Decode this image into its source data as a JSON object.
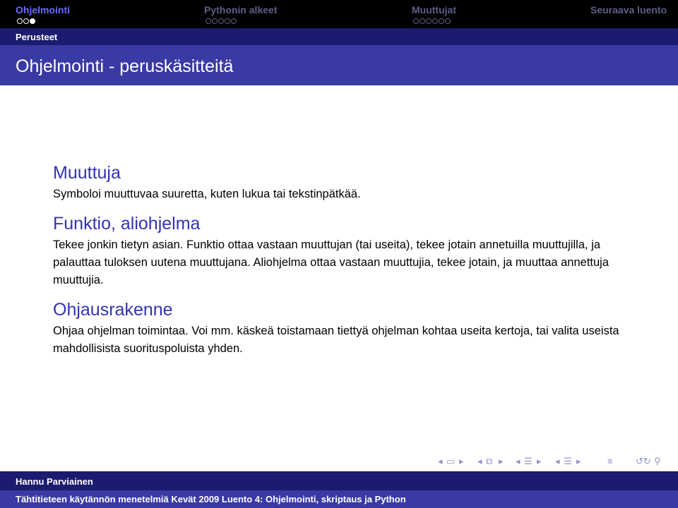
{
  "nav": {
    "sections": [
      {
        "label": "Ohjelmointi",
        "active": true
      },
      {
        "label": "Pythonin alkeet",
        "active": false
      },
      {
        "label": "Muuttujat",
        "active": false
      },
      {
        "label": "Seuraava luento",
        "active": false
      }
    ]
  },
  "subsection": "Perusteet",
  "frame_title": "Ohjelmointi - peruskäsitteitä",
  "blocks": [
    {
      "title": "Muuttuja",
      "text": "Symboloi muuttuvaa suuretta, kuten lukua tai tekstinpätkää."
    },
    {
      "title": "Funktio, aliohjelma",
      "text": "Tekee jonkin tietyn asian. Funktio ottaa vastaan muuttujan (tai useita), tekee jotain annetuilla muuttujilla, ja palauttaa tuloksen uutena muuttujana. Aliohjelma ottaa vastaan muuttujia, tekee jotain, ja muuttaa annettuja muuttujia."
    },
    {
      "title": "Ohjausrakenne",
      "text": "Ohjaa ohjelman toimintaa. Voi mm. käskeä toistamaan tiettyä ohjelman kohtaa useita kertoja, tai valita useista mahdollisista suorituspoluista yhden."
    }
  ],
  "footer": {
    "author": "Hannu Parviainen",
    "title": "Tähtitieteen käytännön menetelmiä Kevät 2009 Luento 4: Ohjelmointi, skriptaus ja Python"
  },
  "colors": {
    "nav_bg": "#000000",
    "subsection_bg": "#1b1b6f",
    "title_bg": "#3a3aa4",
    "block_title": "#3333b3",
    "active_nav": "#6b6bff"
  },
  "icons": [
    "frame-prev-icon",
    "frame-next-icon",
    "subsection-prev-icon",
    "subsection-next-icon",
    "section-prev-icon",
    "section-next-icon",
    "appendix-icon",
    "search-icon"
  ]
}
